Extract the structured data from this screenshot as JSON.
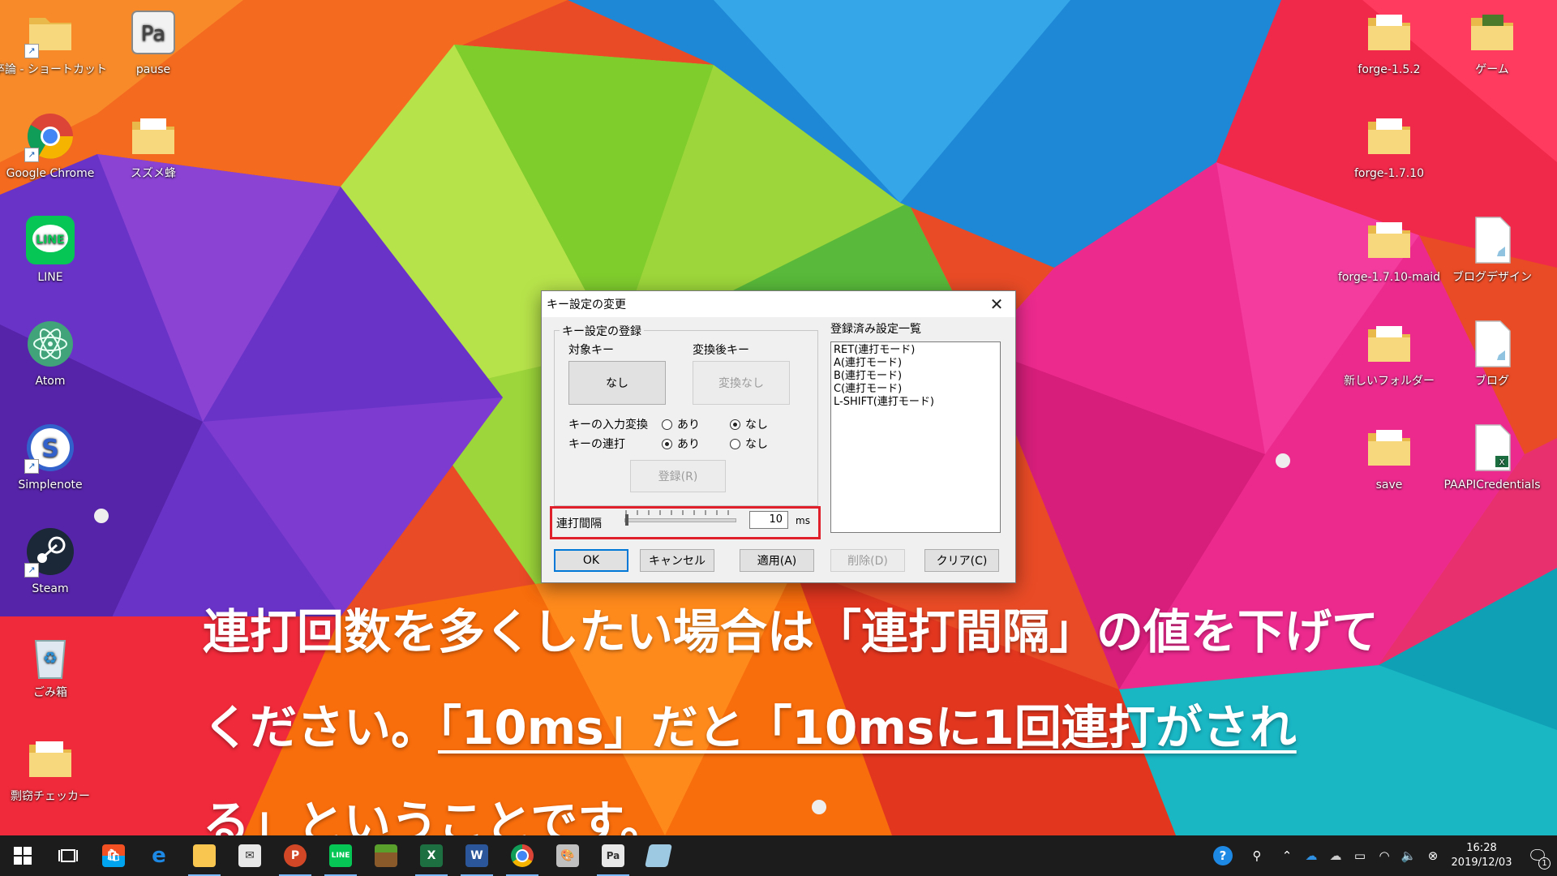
{
  "desktop": {
    "icons": [
      {
        "label": "卒論 - ショートカット",
        "icon": "folder-icon",
        "shortcut": true
      },
      {
        "label": "pause",
        "icon": "pause-app-icon",
        "shortcut": false
      },
      {
        "label": "Google Chrome",
        "icon": "chrome-icon",
        "shortcut": true
      },
      {
        "label": "スズメ蜂",
        "icon": "folder-icon",
        "shortcut": false
      },
      {
        "label": "LINE",
        "icon": "line-icon",
        "shortcut": false
      },
      {
        "label": "Atom",
        "icon": "atom-icon",
        "shortcut": false
      },
      {
        "label": "Simplenote",
        "icon": "simplenote-icon",
        "shortcut": true
      },
      {
        "label": "Steam",
        "icon": "steam-icon",
        "shortcut": true
      },
      {
        "label": "ごみ箱",
        "icon": "recycle-bin-icon",
        "shortcut": false
      },
      {
        "label": "剽窃チェッカー",
        "icon": "folder-icon",
        "shortcut": false
      },
      {
        "label": "forge-1.5.2",
        "icon": "folder-icon",
        "shortcut": false
      },
      {
        "label": "ゲーム",
        "icon": "folder-icon",
        "shortcut": false
      },
      {
        "label": "forge-1.7.10",
        "icon": "folder-icon",
        "shortcut": false
      },
      {
        "label": "forge-1.7.10-maid",
        "icon": "folder-icon",
        "shortcut": false
      },
      {
        "label": "ブログデザイン",
        "icon": "document-icon",
        "shortcut": false
      },
      {
        "label": "新しいフォルダー",
        "icon": "folder-icon",
        "shortcut": false
      },
      {
        "label": "ブログ",
        "icon": "document-icon",
        "shortcut": false
      },
      {
        "label": "save",
        "icon": "folder-icon",
        "shortcut": false
      },
      {
        "label": "PAAPICredentials",
        "icon": "excel-file-icon",
        "shortcut": false
      }
    ]
  },
  "dialog": {
    "title": "キー設定の変更",
    "close_glyph": "✕",
    "group_title": "キー設定の登録",
    "target_key_label": "対象キー",
    "target_key_button": "なし",
    "converted_key_label": "変換後キー",
    "converted_key_button": "変換なし",
    "input_conversion_label": "キーの入力変換",
    "rapid_fire_label": "キーの連打",
    "option_yes": "あり",
    "option_no": "なし",
    "input_conversion_selected": "なし",
    "rapid_fire_selected": "あり",
    "register_button": "登録(R)",
    "list_title": "登録済み設定一覧",
    "list_items": [
      "RET(連打モード)",
      "A(連打モード)",
      "B(連打モード)",
      "C(連打モード)",
      "L-SHIFT(連打モード)"
    ],
    "interval_label": "連打間隔",
    "interval_value": "10",
    "interval_unit": "ms",
    "interval_slider_level": 0.0,
    "highlight_color": "#e0202a",
    "buttons": {
      "ok": "OK",
      "cancel": "キャンセル",
      "apply": "適用(A)",
      "delete": "削除(D)",
      "clear": "クリア(C)"
    }
  },
  "caption": {
    "line1": "連打回数を多くしたい場合は「連打間隔」の値を下げて",
    "line2_plain": "ください。",
    "line2_underlined": "「10ms」だと「10msに1回連打がされ",
    "line3_underlined": "る」",
    "line3_plain": "ということです。"
  },
  "taskbar": {
    "apps": [
      {
        "name": "start-button",
        "icon": "windows-icon",
        "color": "#ffffff",
        "running": false
      },
      {
        "name": "task-view-button",
        "icon": "task-view-icon",
        "color": "#ffffff",
        "running": false
      },
      {
        "name": "store",
        "icon": "store-icon",
        "color": "#f4f4f4",
        "running": false
      },
      {
        "name": "edge",
        "icon": "edge-icon",
        "color": "#1e88e5",
        "running": false
      },
      {
        "name": "file-explorer",
        "icon": "folder-icon",
        "color": "#f9c74f",
        "running": true
      },
      {
        "name": "mail",
        "icon": "mail-icon",
        "color": "#e8e8e8",
        "running": false
      },
      {
        "name": "powerpoint",
        "icon": "powerpoint-icon",
        "color": "#d24726",
        "running": true
      },
      {
        "name": "line",
        "icon": "line-icon",
        "color": "#06c755",
        "running": true
      },
      {
        "name": "minecraft",
        "icon": "minecraft-icon",
        "color": "#6d8a3a",
        "running": false
      },
      {
        "name": "excel",
        "icon": "excel-icon",
        "color": "#1d6f42",
        "running": true
      },
      {
        "name": "word",
        "icon": "word-icon",
        "color": "#2b579a",
        "running": true
      },
      {
        "name": "chrome",
        "icon": "chrome-icon",
        "color": "#4285f4",
        "running": true
      },
      {
        "name": "paint",
        "icon": "paint-icon",
        "color": "#c0c0c0",
        "running": false
      },
      {
        "name": "pause",
        "icon": "pause-app-icon",
        "color": "#e8e8e8",
        "running": true
      },
      {
        "name": "app",
        "icon": "glass-app-icon",
        "color": "#9ec9e2",
        "running": false
      }
    ],
    "tray": {
      "time": "16:28",
      "date": "2019/12/03",
      "notification_count": "1"
    }
  }
}
